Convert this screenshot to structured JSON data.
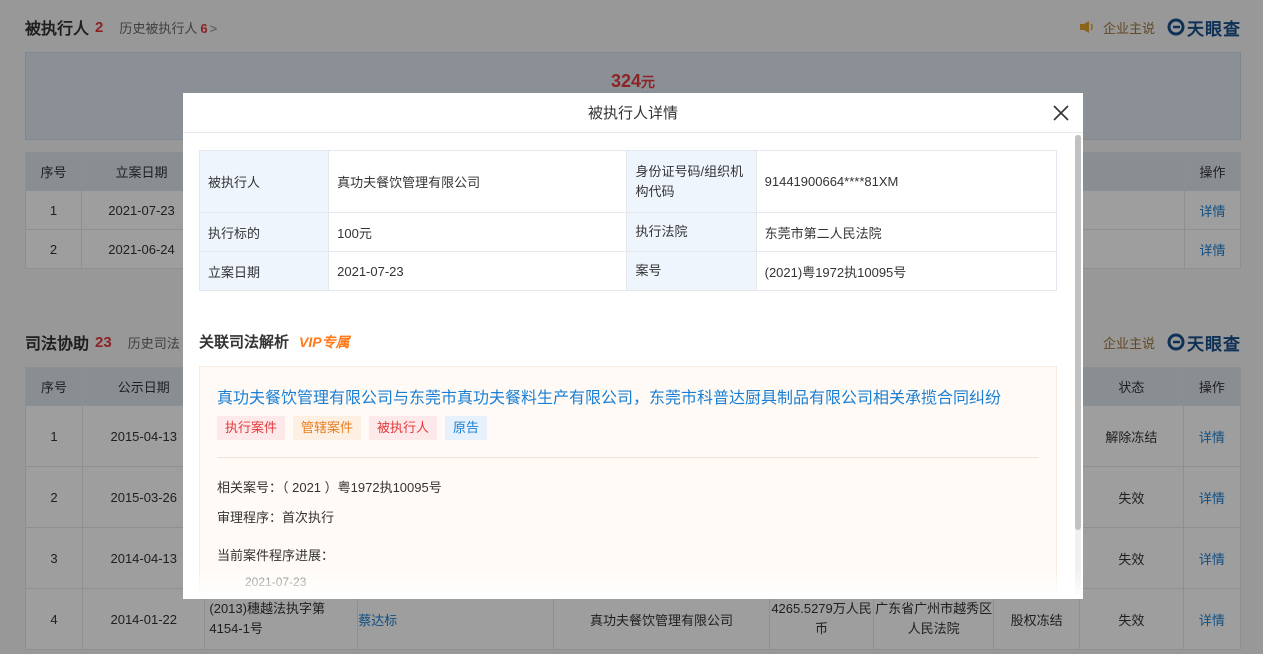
{
  "section1": {
    "title": "被执行人",
    "count": "2",
    "history_label": "历史被执行人",
    "history_count": "6",
    "history_arrow": ">",
    "say_label": "企业主说",
    "logo_text": "天眼查",
    "amount": "324",
    "amount_unit": "元",
    "headers": [
      "序号",
      "立案日期",
      "操作"
    ],
    "rows": [
      {
        "no": "1",
        "date": "2021-07-23",
        "action": "详情"
      },
      {
        "no": "2",
        "date": "2021-06-24",
        "action": "详情"
      }
    ]
  },
  "section2": {
    "title": "司法协助",
    "count": "23",
    "history_label": "历史司法",
    "say_label": "企业主说",
    "logo_text": "天眼查",
    "headers": [
      "序号",
      "公示日期",
      "状态",
      "操作"
    ],
    "rows": [
      {
        "no": "1",
        "date": "2015-04-13",
        "status": "解除冻结",
        "action": "详情"
      },
      {
        "no": "2",
        "date": "2015-03-26",
        "status": "失效",
        "action": "详情"
      },
      {
        "no": "3",
        "date": "2014-04-13",
        "status": "失效",
        "action": "详情"
      },
      {
        "no": "4",
        "date": "2014-01-22",
        "case_no": "(2013)穗越法执字第4154-1号",
        "person": "蔡达标",
        "company": "真功夫餐饮管理有限公司",
        "amount": "4265.5279万人民币",
        "court": "广东省广州市越秀区人民法院",
        "type": "股权冻结",
        "status": "失效",
        "action": "详情"
      }
    ]
  },
  "modal": {
    "title": "被执行人详情",
    "close_label": "×",
    "detail": {
      "row1": {
        "k1": "被执行人",
        "v1": "真功夫餐饮管理有限公司",
        "k2": "身份证号码/组织机构代码",
        "v2": "91441900664****81XM"
      },
      "row2": {
        "k1": "执行标的",
        "v1": "100元",
        "k2": "执行法院",
        "v2": "东莞市第二人民法院"
      },
      "row3": {
        "k1": "立案日期",
        "v1": "2021-07-23",
        "k2": "案号",
        "v2": "(2021)粤1972执10095号"
      }
    },
    "related_title": "关联司法解析",
    "vip_label": "VIP专属",
    "case": {
      "name": "真功夫餐饮管理有限公司与东莞市真功夫餐料生产有限公司，东莞市科普达厨具制品有限公司相关承揽合同纠纷",
      "tags": [
        "执行案件",
        "管辖案件",
        "被执行人",
        "原告"
      ],
      "case_no_line": "相关案号：（ 2021 ）粤1972执10095号",
      "procedure_line": "审理程序：首次执行",
      "progress_label": "当前案件程序进展：",
      "progress_date": "2021-07-23"
    }
  },
  "colors": {
    "accent_red": "#e4393c",
    "link_blue": "#1a7fd4",
    "vip_orange": "#ff7a1a"
  }
}
